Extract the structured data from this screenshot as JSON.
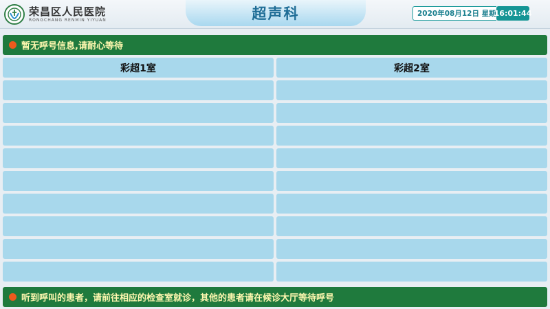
{
  "hospital": {
    "name": "荣昌区人民医院",
    "name_en": "RONGCHANG RENMIN YIYUAN"
  },
  "department": "超声科",
  "date": "2020年08月12日 星期三",
  "time": "16:01:44",
  "notice": "暂无呼号信息,请耐心等待",
  "footer": "听到呼叫的患者，请前往相应的检查室就诊，其他的患者请在候诊大厅等待呼号",
  "rooms": [
    {
      "name": "彩超1室",
      "patients": [
        "",
        "",
        "",
        "",
        "",
        "",
        "",
        "",
        ""
      ]
    },
    {
      "name": "彩超2室",
      "patients": [
        "",
        "",
        "",
        "",
        "",
        "",
        "",
        "",
        ""
      ]
    }
  ],
  "colors": {
    "banner": "#1f7a3d",
    "banner_text": "#fff8b0",
    "cell": "#a8d8ec",
    "title": "#1f6d96",
    "time_bg": "#159595",
    "dot": "#ee5a1d"
  }
}
